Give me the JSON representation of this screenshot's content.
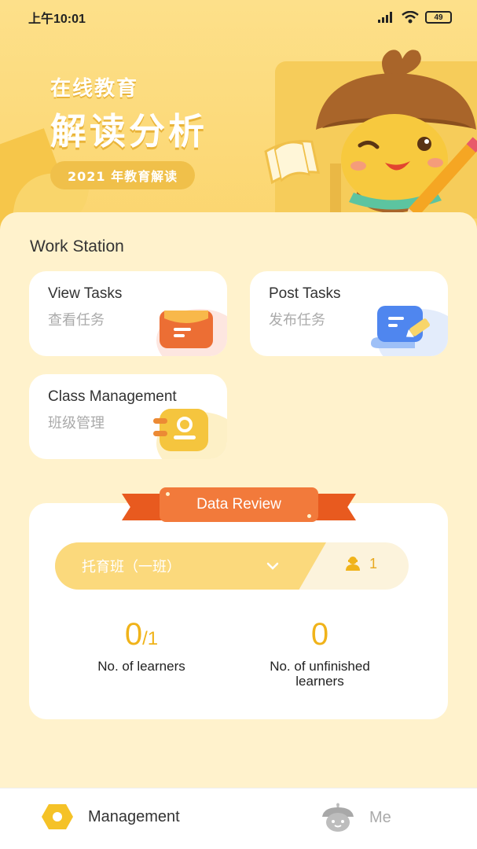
{
  "status_bar": {
    "time": "上午10:01",
    "battery": "49"
  },
  "banner": {
    "subtitle": "在线教育",
    "title": "解读分析",
    "pill": "2021 年教育解读"
  },
  "workstation": {
    "title": "Work Station",
    "cards": [
      {
        "en": "View Tasks",
        "zh": "查看任务",
        "icon": "task-list-icon",
        "color": "#ec6e34"
      },
      {
        "en": "Post Tasks",
        "zh": "发布任务",
        "icon": "post-document-icon",
        "color": "#4f86ef"
      },
      {
        "en": "Class Management",
        "zh": "班级管理",
        "icon": "notebook-icon",
        "color": "#f5c53e"
      }
    ]
  },
  "data_review": {
    "ribbon": "Data Review",
    "class_selector": {
      "value": "托育班（一班）",
      "member_count": "1"
    },
    "stats": [
      {
        "value": "0",
        "total": "/1",
        "label": "No. of learners"
      },
      {
        "value": "0",
        "label": "No. of unfinished learners"
      }
    ]
  },
  "tabbar": {
    "items": [
      {
        "label": "Management",
        "icon": "hexagon-management-icon",
        "active": true
      },
      {
        "label": "Me",
        "icon": "acorn-profile-icon",
        "active": false
      }
    ]
  },
  "colors": {
    "accent": "#f0b31a",
    "ribbon": "#f27a3b",
    "background": "#fff2cc"
  }
}
